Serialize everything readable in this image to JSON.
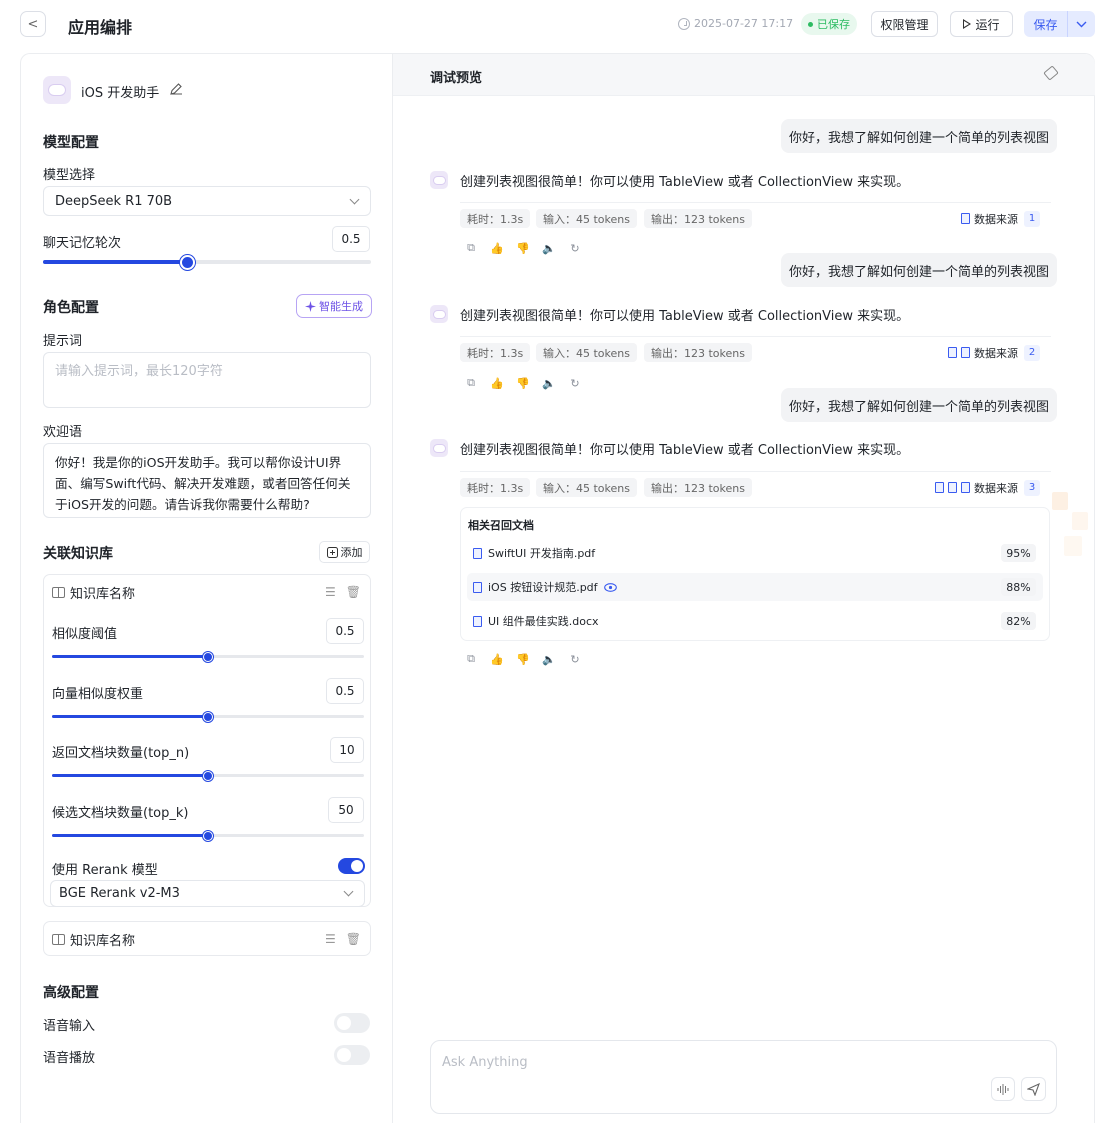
{
  "header": {
    "back_glyph": "<",
    "title": "应用编排",
    "timestamp": "2025-07-27 17:17",
    "saved_status": "已保存",
    "permissions": "权限管理",
    "run": "运行",
    "save": "保存"
  },
  "app": {
    "name": "iOS 开发助手"
  },
  "model_config": {
    "section": "模型配置",
    "model_label": "模型选择",
    "model_value": "DeepSeek R1 70B",
    "memory_label": "聊天记忆轮次",
    "memory_value": "0.5",
    "memory_fraction": 0.44
  },
  "role_config": {
    "section": "角色配置",
    "smart_generate": "智能生成",
    "prompt_label": "提示词",
    "prompt_placeholder": "请输入提示词，最长120字符",
    "welcome_label": "欢迎语",
    "welcome_text": "你好！我是你的iOS开发助手。我可以帮你设计UI界面、编写Swift代码、解决开发难题，或者回答任何关于iOS开发的问题。请告诉我你需要什么帮助?"
  },
  "knowledge": {
    "section": "关联知识库",
    "add": "添加",
    "card_title": "知识库名称",
    "params": [
      {
        "label": "相似度阈值",
        "value": "0.5",
        "fraction": 0.5
      },
      {
        "label": "向量相似度权重",
        "value": "0.5",
        "fraction": 0.5
      },
      {
        "label": "返回文档块数量(top_n)",
        "value": "10",
        "fraction": 0.5
      },
      {
        "label": "候选文档块数量(top_k)",
        "value": "50",
        "fraction": 0.5
      }
    ],
    "rerank_label": "使用 Rerank 模型",
    "rerank_on": true,
    "rerank_model": "BGE Rerank v2-M3",
    "card2_title": "知识库名称"
  },
  "advanced": {
    "section": "高级配置",
    "voice_input": "语音输入",
    "voice_output": "语音播放",
    "voice_input_on": false,
    "voice_output_on": false
  },
  "preview": {
    "title": "调试预览",
    "user_msg": "你好，我想了解如何创建一个简单的列表视图",
    "assistant_msg": "创建列表视图很简单！你可以使用 TableView 或者 CollectionView 来实现。",
    "meta": {
      "time": "耗时：1.3s",
      "input": "输入：45 tokens",
      "output": "输出：123 tokens",
      "source": "数据来源"
    },
    "source_counts": [
      "1",
      "2",
      "3"
    ],
    "recall": {
      "title": "相关召回文档",
      "docs": [
        {
          "name": "SwiftUI 开发指南.pdf",
          "score": "95%"
        },
        {
          "name": "iOS 按钮设计规范.pdf",
          "score": "88%"
        },
        {
          "name": "UI 组件最佳实践.docx",
          "score": "82%"
        }
      ]
    },
    "input_placeholder": "Ask Anything"
  },
  "colors": {
    "accent": "#2448e0",
    "saved_green": "#2dbb62",
    "smart_purple": "#6e53e6"
  },
  "icons": [
    "chevron-left-icon",
    "clock-icon",
    "play-icon",
    "chevron-down-icon",
    "pencil-icon",
    "sparkle-icon",
    "plus-square-icon",
    "book-icon",
    "list-icon",
    "trash-icon",
    "eraser-icon",
    "doc-icon",
    "copy-icon",
    "thumb-up-icon",
    "thumb-down-icon",
    "speaker-icon",
    "refresh-icon",
    "eye-icon",
    "waveform-icon",
    "send-icon"
  ]
}
